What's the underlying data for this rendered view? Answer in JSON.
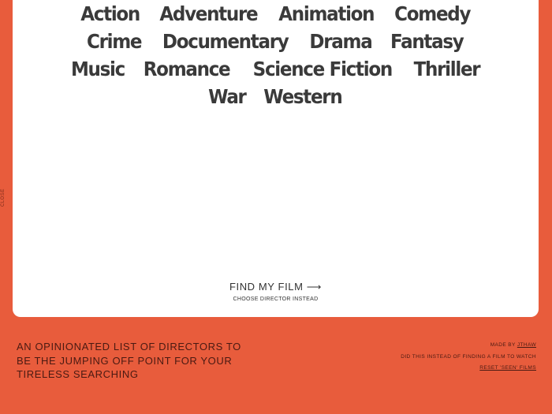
{
  "genres": [
    [
      "Action",
      "Adventure",
      "Animation",
      "Comedy"
    ],
    [
      "Crime",
      "Documentary",
      "Drama",
      "Fantasy"
    ],
    [
      "Music",
      "Romance",
      "Science Fiction",
      "Thriller"
    ],
    [
      "War",
      "Western"
    ]
  ],
  "sidebar": {
    "close_label": "CLOSE"
  },
  "actions": {
    "find_label": "FIND MY FILM",
    "find_arrow": "⟶",
    "choose_label": "CHOOSE DIRECTOR INSTEAD"
  },
  "footer": {
    "tagline": "AN OPINIONATED LIST OF DIRECTORS TO BE THE JUMPING OFF POINT FOR YOUR TIRELESS SEARCHING",
    "made_by_prefix": "MADE BY ",
    "made_by_link": "JTHAW",
    "note": "DID THIS INSTEAD OF FINDING A FILM TO WATCH",
    "reset_link": "RESET 'SEEN' FILMS"
  },
  "colors": {
    "background": "#E85C3C",
    "panel": "#FFFFFF",
    "genre_text": "#3A3A3A"
  }
}
